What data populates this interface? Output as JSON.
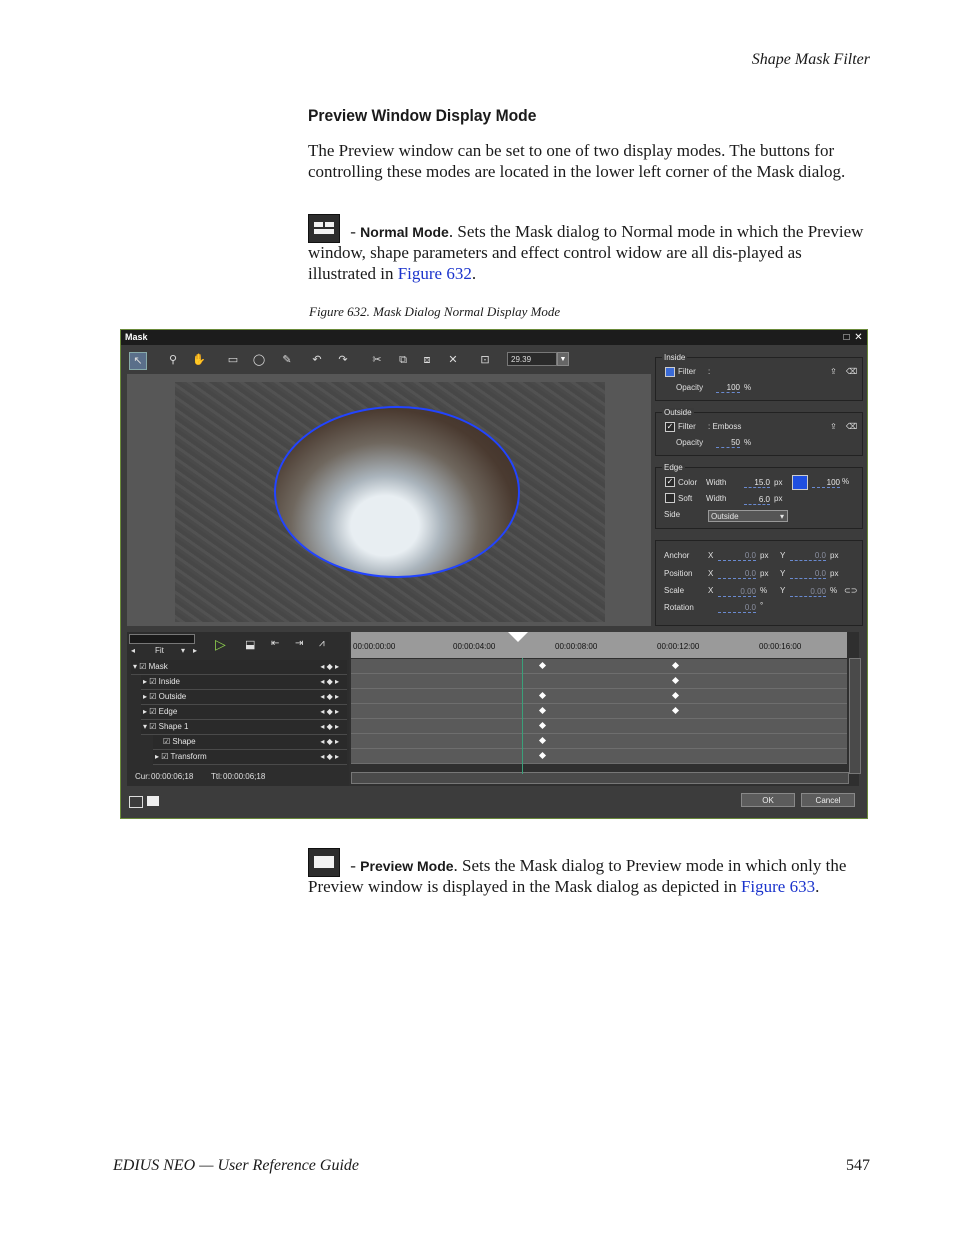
{
  "running_head": "Shape Mask Filter",
  "section_title": "Preview Window Display Mode",
  "paragraph1": "The Preview window can be set to one of two display modes. The buttons for controlling these modes are located in the lower left corner of the Mask dialog.",
  "normal_mode": {
    "label": "Normal Mode",
    "text_before": " - ",
    "text_after": ". Sets the Mask dialog to Normal mode in which the Preview window, shape parameters and effect control widow are all dis-played as illustrated in ",
    "link": "Figure 632",
    "end": "."
  },
  "figure_caption": "Figure 632.  Mask Dialog Normal Display Mode",
  "preview_mode": {
    "label": "Preview Mode",
    "text_before": " - ",
    "text_after": ". Sets the Mask dialog to Preview mode in which only the Preview window is displayed in the Mask dialog as depicted in ",
    "link": "Figure 633",
    "end": "."
  },
  "footer": {
    "left": "EDIUS NEO  —  User Reference Guide",
    "page": "547"
  },
  "screenshot": {
    "title": "Mask",
    "zoom_value": "29.39",
    "inside": {
      "legend": "Inside",
      "filter_label": "Filter",
      "filter_sep": ":",
      "opacity_label": "Opacity",
      "opacity_value": "100",
      "opacity_unit": "%"
    },
    "outside": {
      "legend": "Outside",
      "filter_label": "Filter",
      "filter_value": ":  Emboss",
      "opacity_label": "Opacity",
      "opacity_value": "50",
      "opacity_unit": "%"
    },
    "edge": {
      "legend": "Edge",
      "color_label": "Color",
      "width_label": "Width",
      "color_width": "15.0",
      "px": "px",
      "color_percent": "100",
      "percent": "%",
      "soft_label": "Soft",
      "soft_width": "6.0",
      "side_label": "Side",
      "side_value": "Outside",
      "edge_color": "#1f4fe0"
    },
    "transform": {
      "anchor": "Anchor",
      "position": "Position",
      "scale": "Scale",
      "rotation": "Rotation",
      "x": "X",
      "y": "Y",
      "zero": "0.0",
      "zero2": "0.00",
      "px": "px",
      "percent": "%",
      "deg": "°"
    },
    "fit_label": "Fit",
    "tracks": [
      "Mask",
      "Inside",
      "Outside",
      "Edge",
      "Shape 1",
      "Shape",
      "Transform"
    ],
    "timecodes": [
      "00:00:00:00",
      "00:00:04:00",
      "00:00:08:00",
      "00:00:12:00",
      "00:00:16:00"
    ],
    "cur_label": "Cur:",
    "cur_value": "00:00:06;18",
    "ttl_label": "Ttl:",
    "ttl_value": "00:00:06;18",
    "ok": "OK",
    "cancel": "Cancel"
  }
}
